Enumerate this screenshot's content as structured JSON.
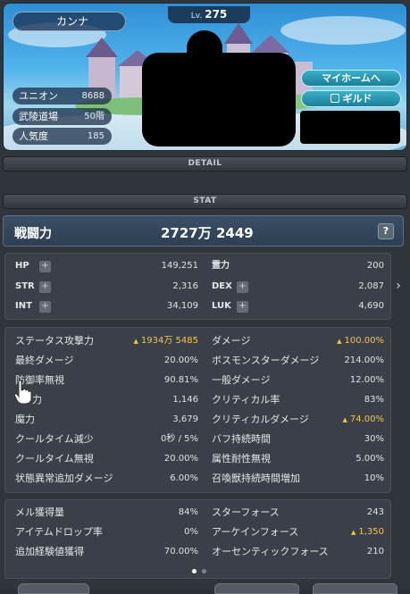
{
  "profile": {
    "name": "カンナ",
    "level_label": "Lv.",
    "level": "275",
    "union_label": "ユニオン",
    "union_value": "8688",
    "dojo_label": "武陵道場",
    "dojo_value": "50階",
    "popularity_label": "人気度",
    "popularity_value": "185",
    "home_button": "マイホームへ",
    "guild_button": "ギルド"
  },
  "sections": {
    "detail": "DETAIL",
    "stat": "STAT"
  },
  "power": {
    "label": "戦闘力",
    "value": "2727万 2449",
    "help": "?"
  },
  "basic": [
    {
      "k1": "HP",
      "v1": "149,251",
      "k2": "霊力",
      "v2": "200"
    },
    {
      "k1": "STR",
      "v1": "2,316",
      "k2": "DEX",
      "v2": "2,087"
    },
    {
      "k1": "INT",
      "v1": "34,109",
      "k2": "LUK",
      "v2": "4,690"
    }
  ],
  "detail": [
    {
      "k1": "ステータス攻撃力",
      "v1": "1934万 5485",
      "v1_up": true,
      "k2": "ダメージ",
      "v2": "100.00%",
      "v2_up": true
    },
    {
      "k1": "最終ダメージ",
      "v1": "20.00%",
      "k2": "ボスモンスターダメージ",
      "v2": "214.00%"
    },
    {
      "k1": "防御率無視",
      "v1": "90.81%",
      "k2": "一般ダメージ",
      "v2": "12.00%"
    },
    {
      "k1": "力",
      "v1": "1,146",
      "k2": "クリティカル率",
      "v2": "83%"
    },
    {
      "k1": "魔力",
      "v1": "3,679",
      "k2": "クリティカルダメージ",
      "v2": "74.00%",
      "v2_up": true
    },
    {
      "k1": "クールタイム減少",
      "v1": "0秒 / 5%",
      "k2": "バフ持続時間",
      "v2": "30%"
    },
    {
      "k1": "クールタイム無視",
      "v1": "20.00%",
      "k2": "属性耐性無視",
      "v2": "5.00%"
    },
    {
      "k1": "状態異常追加ダメージ",
      "v1": "6.00%",
      "k2": "召喚獣持続時間増加",
      "v2": "10%"
    }
  ],
  "extra": [
    {
      "k1": "メル獲得量",
      "v1": "84%",
      "k2": "スターフォース",
      "v2": "243"
    },
    {
      "k1": "アイテムドロップ率",
      "v1": "0%",
      "k2": "アーケインフォース",
      "v2": "1,350",
      "v2_up": true
    },
    {
      "k1": "追加経験値獲得",
      "v1": "70.00%",
      "k2": "オーセンティックフォース",
      "v2": "210"
    }
  ],
  "colors": {
    "highlight": "#f4c34a",
    "panel": "#3b4048",
    "accent_button": "#1d7f98"
  }
}
